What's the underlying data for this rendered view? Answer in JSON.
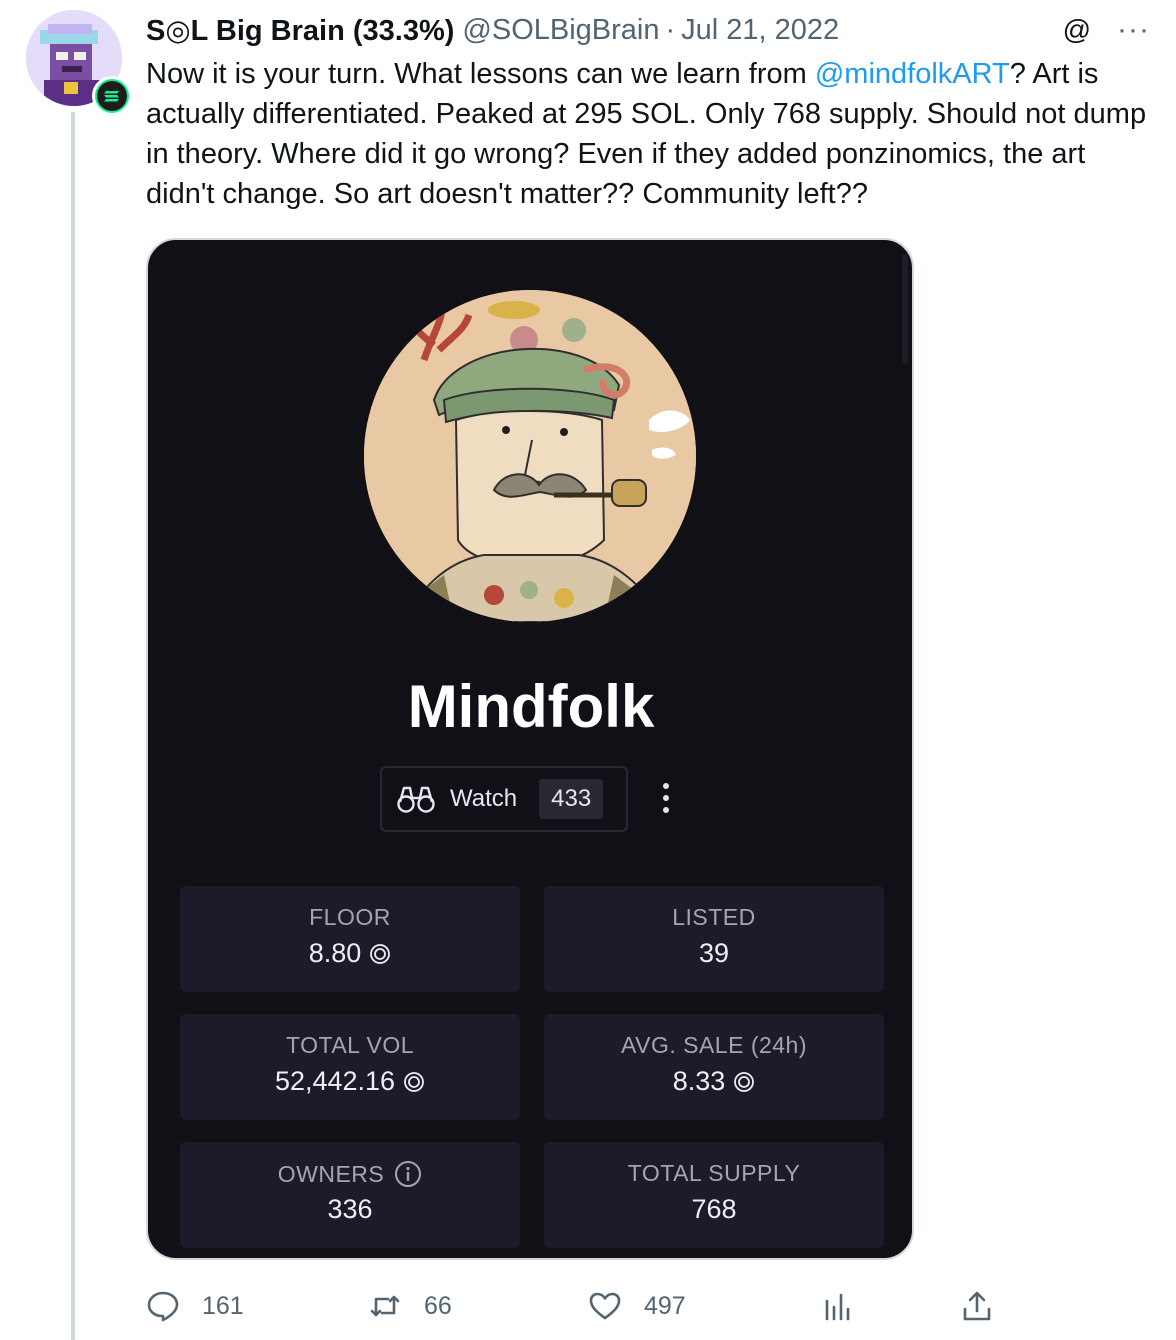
{
  "author": {
    "name": "S◎L Big Brain (33.3%)",
    "handle": "@SOLBigBrain",
    "separator": "·",
    "date": "Jul 21, 2022"
  },
  "top_actions": {
    "at_icon": "@",
    "more_icon": "···"
  },
  "tweet": {
    "text_before_mention": "Now it is your turn. What lessons can we learn from ",
    "mention": "@mindfolkART",
    "text_after_mention": "?  Art is actually differentiated. Peaked at 295 SOL. Only 768 supply. Should not dump in theory. Where did it go wrong? Even if they added ponzinomics, the art didn't change. So art doesn't matter?? Community left??"
  },
  "media": {
    "collection_name": "Mindfolk",
    "watch": {
      "label": "Watch",
      "count": "433"
    },
    "stats": [
      {
        "label": "FLOOR",
        "value": "8.80",
        "sol": true
      },
      {
        "label": "LISTED",
        "value": "39",
        "sol": false
      },
      {
        "label": "TOTAL VOL",
        "value": "52,442.16",
        "sol": true
      },
      {
        "label": "AVG. SALE (24h)",
        "value": "8.33",
        "sol": true
      },
      {
        "label": "OWNERS",
        "value": "336",
        "sol": false,
        "info": true
      },
      {
        "label": "TOTAL SUPPLY",
        "value": "768",
        "sol": false
      }
    ]
  },
  "actions": {
    "replies": "161",
    "retweets": "66",
    "likes": "497"
  },
  "icons": [
    "at-icon",
    "more-icon",
    "binoculars-icon",
    "kebab-icon",
    "sol-icon",
    "info-icon",
    "reply-icon",
    "retweet-icon",
    "like-icon",
    "views-icon",
    "share-icon"
  ],
  "colors": {
    "link": "#1d9bf0",
    "muted": "#536471",
    "card_bg": "#121017",
    "stat_bg": "#1e1a29"
  }
}
